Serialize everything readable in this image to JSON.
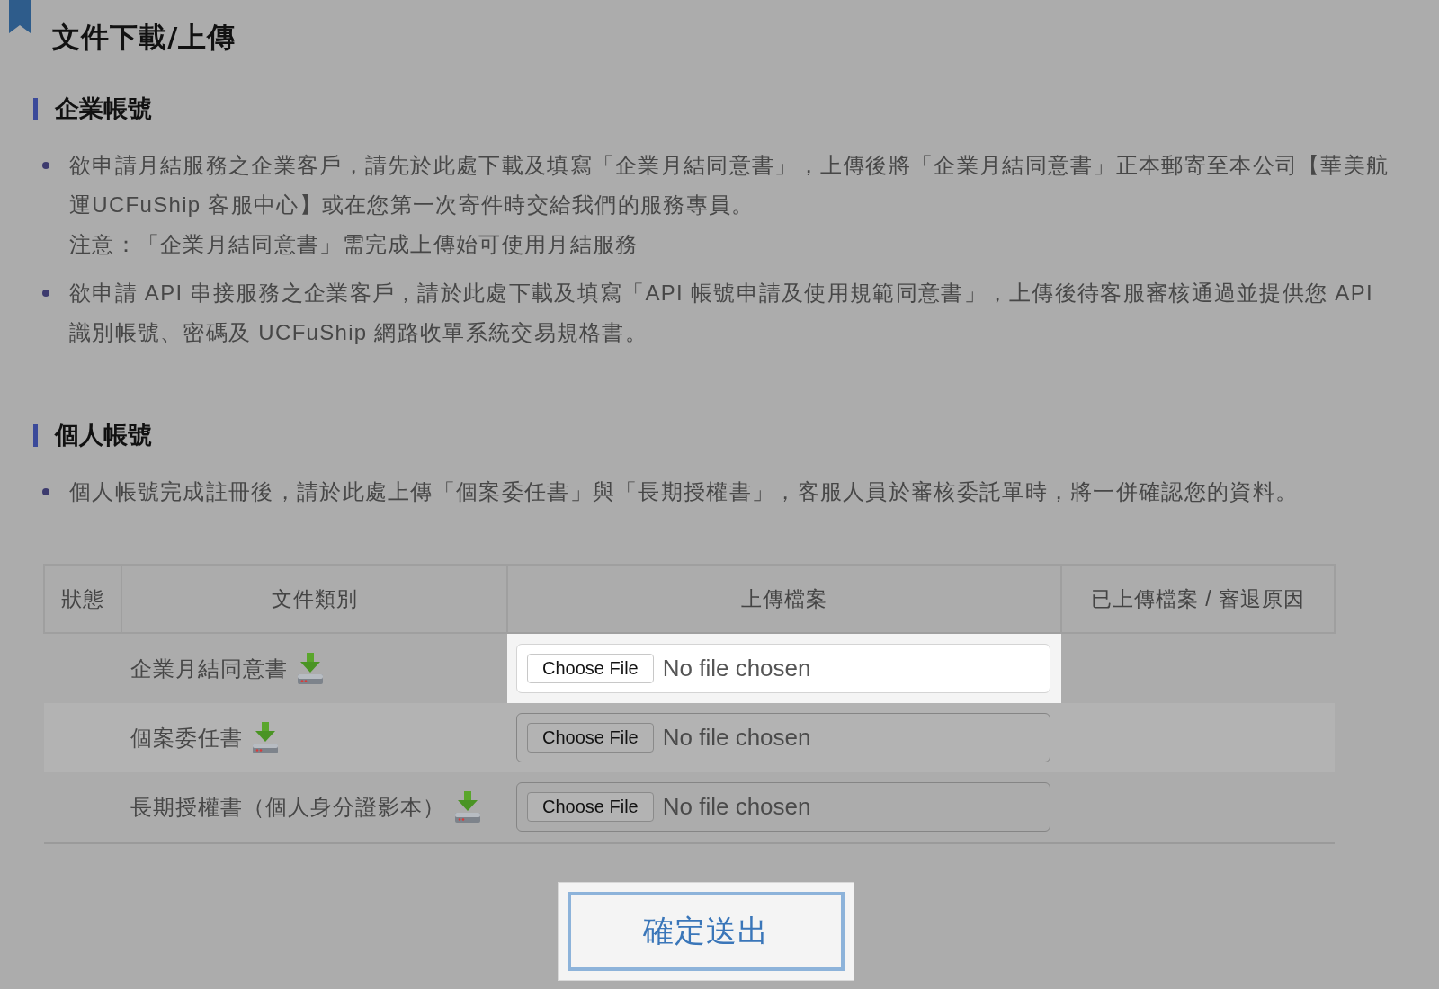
{
  "page": {
    "title": "文件下載/上傳"
  },
  "sections": [
    {
      "heading": "企業帳號",
      "items": [
        {
          "paragraphs": [
            "欲申請月結服務之企業客戶，請先於此處下載及填寫「企業月結同意書」，上傳後將「企業月結同意書」正本郵寄至本公司【華美航運UCFuShip 客服中心】或在您第一次寄件時交給我們的服務專員。",
            "注意：「企業月結同意書」需完成上傳始可使用月結服務"
          ]
        },
        {
          "paragraphs": [
            "欲申請 API 串接服務之企業客戶，請於此處下載及填寫「API 帳號申請及使用規範同意書」，上傳後待客服審核通過並提供您 API 識別帳號、密碼及 UCFuShip 網路收單系統交易規格書。"
          ]
        }
      ]
    },
    {
      "heading": "個人帳號",
      "items": [
        {
          "paragraphs": [
            "個人帳號完成註冊後，請於此處上傳「個案委任書」與「長期授權書」，客服人員於審核委託單時，將一併確認您的資料。"
          ]
        }
      ]
    }
  ],
  "table": {
    "columns": [
      "狀態",
      "文件類別",
      "上傳檔案",
      "已上傳檔案 / 審退原因"
    ],
    "rows": [
      {
        "document": "企業月結同意書",
        "upload": {
          "button": "Choose File",
          "status": "No file chosen"
        },
        "highlighted": true
      },
      {
        "document": "個案委任書",
        "upload": {
          "button": "Choose File",
          "status": "No file chosen"
        },
        "highlighted": false
      },
      {
        "document": "長期授權書（個人身分證影本）",
        "upload": {
          "button": "Choose File",
          "status": "No file chosen"
        },
        "highlighted": false
      }
    ]
  },
  "submit": {
    "label": "確定送出",
    "highlighted": true
  }
}
